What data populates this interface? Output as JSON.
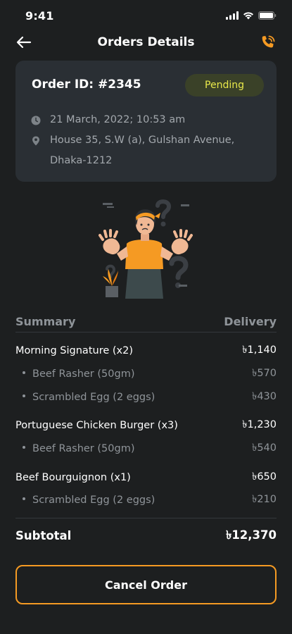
{
  "status_bar": {
    "time": "9:41"
  },
  "header": {
    "title": "Orders Details"
  },
  "order": {
    "id_label": "Order ID: #2345",
    "status": "Pending",
    "date": "21 March, 2022; 10:53 am",
    "address": "House 35, S.W (a), Gulshan Avenue, Dhaka-1212"
  },
  "summary": {
    "left_heading": "Summary",
    "right_heading": "Delivery",
    "lines": [
      {
        "kind": "main",
        "label": "Morning Signature (x2)",
        "price": "৳1,140"
      },
      {
        "kind": "sub",
        "label": "Beef Rasher (50gm)",
        "price": "৳570"
      },
      {
        "kind": "sub",
        "label": "Scrambled Egg (2 eggs)",
        "price": "৳430"
      },
      {
        "kind": "main",
        "label": "Portuguese Chicken Burger (x3)",
        "price": "৳1,230"
      },
      {
        "kind": "sub",
        "label": "Beef Rasher (50gm)",
        "price": "৳540"
      },
      {
        "kind": "main",
        "label": "Beef Bourguignon (x1)",
        "price": "৳650"
      },
      {
        "kind": "sub",
        "label": "Scrambled Egg (2 eggs)",
        "price": "৳210"
      }
    ],
    "subtotal_label": "Subtotal",
    "subtotal_value": "৳12,370"
  },
  "actions": {
    "cancel_label": "Cancel Order"
  },
  "colors": {
    "background": "#1d1f20",
    "card": "#2a2f34",
    "accent": "#f59a23",
    "pending_text": "#e8e84a",
    "muted": "#8f9499"
  },
  "icons": [
    "back-arrow-icon",
    "phone-call-icon",
    "clock-icon",
    "location-pin-icon"
  ]
}
